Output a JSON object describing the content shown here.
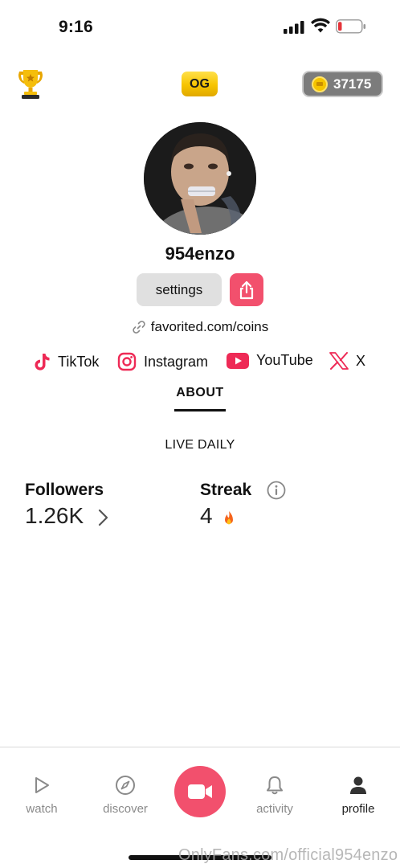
{
  "status_bar": {
    "time": "9:16"
  },
  "header": {
    "badge_label": "OG",
    "coins": "37175"
  },
  "profile": {
    "username": "954enzo",
    "settings_label": "settings",
    "link_text": "favorited.com/coins",
    "socials": [
      {
        "name": "TikTok",
        "icon": "tiktok-icon"
      },
      {
        "name": "Instagram",
        "icon": "instagram-icon"
      },
      {
        "name": "YouTube",
        "icon": "youtube-icon"
      },
      {
        "name": "X",
        "icon": "x-icon"
      }
    ],
    "tab_label": "ABOUT",
    "bio": "LIVE DAILY",
    "stats": {
      "followers_label": "Followers",
      "followers_value": "1.26K",
      "streak_label": "Streak",
      "streak_value": "4"
    }
  },
  "nav": {
    "items": [
      {
        "label": "watch",
        "icon": "play-icon"
      },
      {
        "label": "discover",
        "icon": "compass-icon"
      },
      {
        "label": "",
        "icon": "video-camera-icon"
      },
      {
        "label": "activity",
        "icon": "bell-icon"
      },
      {
        "label": "profile",
        "icon": "person-icon"
      }
    ]
  },
  "watermark": "OnlyFans.com/official954enzo",
  "colors": {
    "accent": "#f2506d",
    "gold": "#f5c400",
    "muted": "#8a8a8a"
  }
}
